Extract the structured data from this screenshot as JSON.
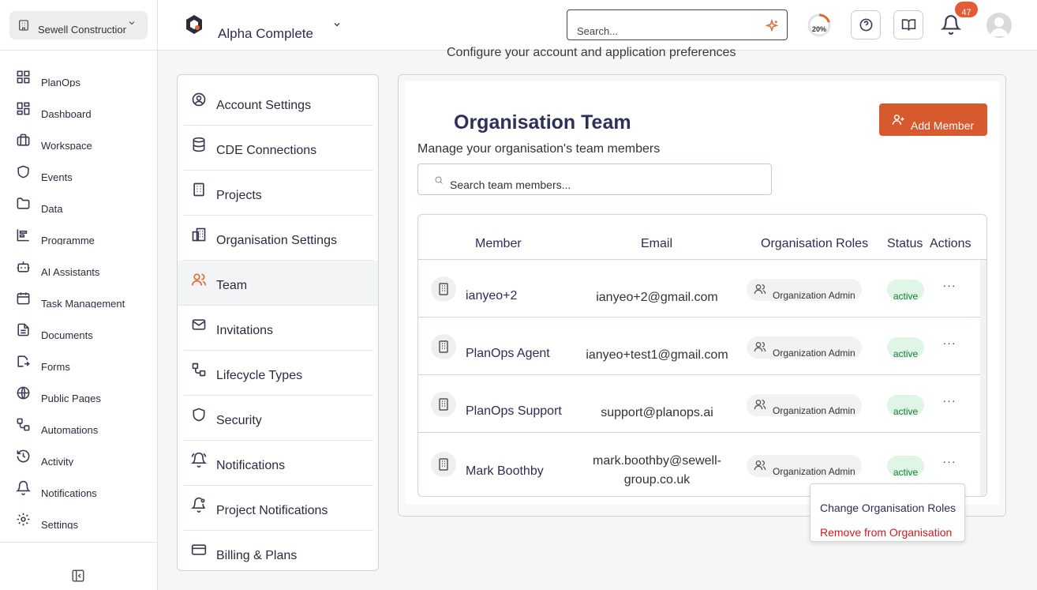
{
  "sidebar": {
    "org_name": "Sewell Construction",
    "items": [
      {
        "label": "PlanOps",
        "icon": "grid-icon"
      },
      {
        "label": "Dashboard",
        "icon": "grid-icon"
      },
      {
        "label": "Workspace",
        "icon": "briefcase-icon"
      },
      {
        "label": "Events",
        "icon": "shield-icon"
      },
      {
        "label": "Data",
        "icon": "folder-icon"
      },
      {
        "label": "Programme",
        "icon": "chart-icon"
      },
      {
        "label": "AI Assistants",
        "icon": "bot-icon"
      },
      {
        "label": "Task Management",
        "icon": "calendar-icon"
      },
      {
        "label": "Documents",
        "icon": "document-icon"
      },
      {
        "label": "Forms",
        "icon": "form-icon"
      },
      {
        "label": "Public Pages",
        "icon": "globe-icon"
      },
      {
        "label": "Automations",
        "icon": "workflow-icon"
      },
      {
        "label": "Activity",
        "icon": "history-icon"
      },
      {
        "label": "Notifications",
        "icon": "bell-icon"
      },
      {
        "label": "Settings",
        "icon": "gear-icon"
      }
    ]
  },
  "topbar": {
    "project_name": "Alpha Complete",
    "search_placeholder": "Search...",
    "progress_label": "20%",
    "progress_fraction": 0.2,
    "notification_count": "47"
  },
  "page": {
    "subtitle": "Configure your account and application preferences"
  },
  "settings_menu": [
    {
      "label": "Account Settings",
      "icon": "user-circle-icon"
    },
    {
      "label": "CDE Connections",
      "icon": "database-icon"
    },
    {
      "label": "Projects",
      "icon": "building-icon"
    },
    {
      "label": "Organisation Settings",
      "icon": "buildings-icon"
    },
    {
      "label": "Team",
      "icon": "users-icon",
      "active": true
    },
    {
      "label": "Invitations",
      "icon": "mail-icon"
    },
    {
      "label": "Lifecycle Types",
      "icon": "workflow-icon"
    },
    {
      "label": "Security",
      "icon": "shield-icon"
    },
    {
      "label": "Notifications",
      "icon": "bell-ring-icon"
    },
    {
      "label": "Project Notifications",
      "icon": "bell-settings-icon"
    },
    {
      "label": "Billing & Plans",
      "icon": "credit-card-icon"
    }
  ],
  "team": {
    "title": "Organisation Team",
    "description": "Manage your organisation's team members",
    "add_button": "Add Member",
    "search_placeholder": "Search team members...",
    "columns": [
      "Member",
      "Email",
      "Organisation Roles",
      "Status",
      "Actions"
    ],
    "members": [
      {
        "name": "ianyeo+2",
        "email": "ianyeo+2@gmail.com",
        "role": "Organization Admin",
        "status": "active"
      },
      {
        "name": "PlanOps Agent",
        "email": "ianyeo+test1@gmail.com",
        "role": "Organization Admin",
        "status": "active"
      },
      {
        "name": "PlanOps Support",
        "email": "support@planops.ai",
        "role": "Organization Admin",
        "status": "active"
      },
      {
        "name": "Mark Boothby",
        "email": "mark.boothby@sewell-group.co.uk",
        "role": "Organization Admin",
        "status": "active"
      }
    ],
    "more_glyph": "···"
  },
  "context_menu": {
    "change_roles": "Change Organisation Roles",
    "remove": "Remove from Organisation"
  },
  "colors": {
    "accent": "#d65a2d",
    "title": "#2f2f5c",
    "danger": "#d0191f",
    "status_bg": "#dff5e6"
  }
}
